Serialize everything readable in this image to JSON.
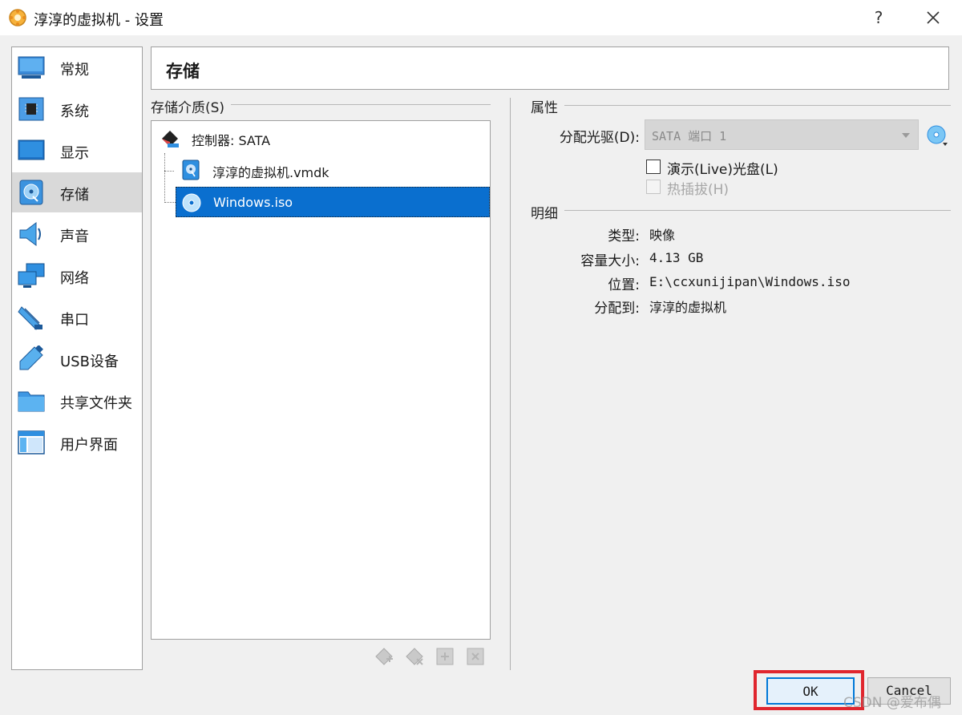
{
  "window": {
    "title": "淳淳的虚拟机 - 设置",
    "help_label": "?"
  },
  "nav": {
    "items": [
      {
        "label": "常规",
        "icon": "general-icon"
      },
      {
        "label": "系统",
        "icon": "system-icon"
      },
      {
        "label": "显示",
        "icon": "display-icon"
      },
      {
        "label": "存储",
        "icon": "storage-icon",
        "selected": true
      },
      {
        "label": "声音",
        "icon": "audio-icon"
      },
      {
        "label": "网络",
        "icon": "network-icon"
      },
      {
        "label": "串口",
        "icon": "serial-port-icon"
      },
      {
        "label": "USB设备",
        "icon": "usb-icon"
      },
      {
        "label": "共享文件夹",
        "icon": "shared-folder-icon"
      },
      {
        "label": "用户界面",
        "icon": "user-interface-icon"
      }
    ]
  },
  "page": {
    "title": "存储"
  },
  "storage": {
    "group_title": "存储介质(S)",
    "tree": [
      {
        "label": "控制器: SATA",
        "icon": "controller-icon",
        "level": 0
      },
      {
        "label": "淳淳的虚拟机.vmdk",
        "icon": "hard-disk-icon",
        "level": 1
      },
      {
        "label": "Windows.iso",
        "icon": "optical-disc-icon",
        "level": 1,
        "selected": true
      }
    ],
    "toolbar": [
      "add-controller-icon",
      "remove-controller-icon",
      "add-attachment-icon",
      "remove-attachment-icon"
    ]
  },
  "attributes": {
    "group_title": "属性",
    "drive_label": "分配光驱(D):",
    "drive_value": "SATA 端口 1",
    "live_cd_label": "演示(Live)光盘(L)",
    "live_cd_checked": false,
    "hotplug_label": "热插拔(H)",
    "hotplug_checked": false,
    "hotplug_enabled": false
  },
  "details": {
    "group_title": "明细",
    "rows": [
      {
        "key": "类型:",
        "value": "映像"
      },
      {
        "key": "容量大小:",
        "value": "4.13 GB"
      },
      {
        "key": "位置:",
        "value": "E:\\ccxunijipan\\Windows.iso"
      },
      {
        "key": "分配到:",
        "value": "淳淳的虚拟机"
      }
    ]
  },
  "buttons": {
    "ok": "OK",
    "cancel": "Cancel"
  },
  "watermark": "CSDN @爱布偶",
  "colors": {
    "selection": "#0a6fcf",
    "highlight_border": "#e0262e",
    "default_button_border": "#0078d7"
  }
}
